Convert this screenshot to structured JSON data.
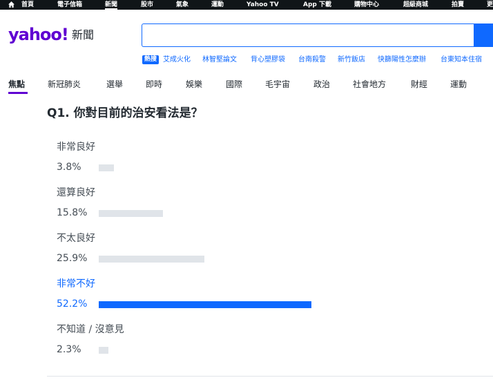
{
  "topnav": [
    {
      "label": "首頁"
    },
    {
      "label": "電子信箱"
    },
    {
      "label": "新聞"
    },
    {
      "label": "股市"
    },
    {
      "label": "氣象"
    },
    {
      "label": "運動"
    },
    {
      "label": "Yahoo TV"
    },
    {
      "label": "App 下載"
    },
    {
      "label": "購物中心"
    },
    {
      "label": "超級商城"
    },
    {
      "label": "拍賣"
    },
    {
      "label": "更"
    }
  ],
  "logo": {
    "brand": "yahoo!",
    "section": "新聞"
  },
  "search": {
    "placeholder": ""
  },
  "trending": {
    "badge": "熱搜",
    "items": [
      "艾成火化",
      "林智堅論文",
      "背心塑膠袋",
      "台南殺警",
      "新竹飯店",
      "快篩陽性怎麼辦",
      "台東知本住宿"
    ]
  },
  "nav": [
    "焦點",
    "新冠肺炎",
    "選舉",
    "即時",
    "娛樂",
    "國際",
    "毛宇宙",
    "政治",
    "社會地方",
    "財經",
    "運動"
  ],
  "poll": {
    "question": "Q1. 你對目前的治安看法是？",
    "options": [
      {
        "label": "非常良好",
        "pct": "3.8%",
        "value": 3.8,
        "selected": false
      },
      {
        "label": "還算良好",
        "pct": "15.8%",
        "value": 15.8,
        "selected": false
      },
      {
        "label": "不太良好",
        "pct": "25.9%",
        "value": 25.9,
        "selected": false
      },
      {
        "label": "非常不好",
        "pct": "52.2%",
        "value": 52.2,
        "selected": true
      },
      {
        "label": "不知道 / 沒意見",
        "pct": "2.3%",
        "value": 2.3,
        "selected": false
      }
    ]
  },
  "colors": {
    "accent": "#0f69ff",
    "brand": "#6001d2",
    "bar": "#e0e4e9"
  }
}
